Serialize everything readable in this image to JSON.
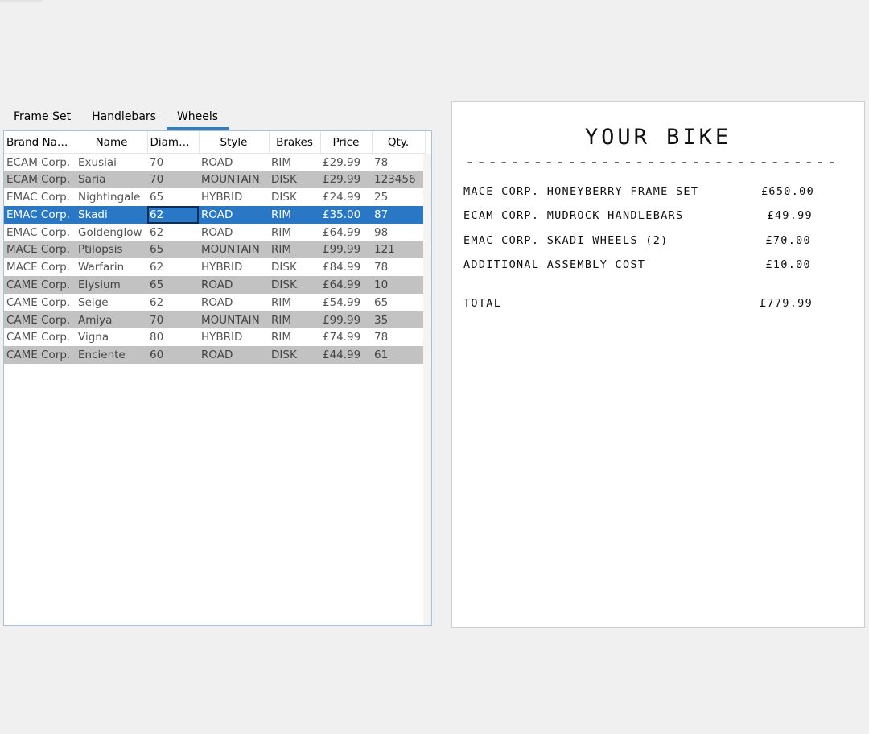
{
  "tabs": [
    {
      "label": "Frame Set",
      "active": false
    },
    {
      "label": "Handlebars",
      "active": false
    },
    {
      "label": "Wheels",
      "active": true
    }
  ],
  "table": {
    "columns": [
      "Brand Name",
      "Name",
      "Diame…",
      "Style",
      "Brakes",
      "Price",
      "Qty."
    ],
    "rows": [
      [
        "ECAM Corp.",
        "Exusiai",
        "70",
        "ROAD",
        "RIM",
        "£29.99",
        "78"
      ],
      [
        "ECAM Corp.",
        "Saria",
        "70",
        "MOUNTAIN",
        "DISK",
        "£29.99",
        "123456"
      ],
      [
        "EMAC Corp.",
        "Nightingale",
        "65",
        "HYBRID",
        "DISK",
        "£24.99",
        "25"
      ],
      [
        "EMAC Corp.",
        "Skadi",
        "62",
        "ROAD",
        "RIM",
        "£35.00",
        "87"
      ],
      [
        "EMAC Corp.",
        "Goldenglow",
        "62",
        "ROAD",
        "RIM",
        "£64.99",
        "98"
      ],
      [
        "MACE Corp.",
        "Ptilopsis",
        "65",
        "MOUNTAIN",
        "RIM",
        "£99.99",
        "121"
      ],
      [
        "MACE Corp.",
        "Warfarin",
        "62",
        "HYBRID",
        "DISK",
        "£84.99",
        "78"
      ],
      [
        "CAME Corp.",
        "Elysium",
        "65",
        "ROAD",
        "DISK",
        "£64.99",
        "10"
      ],
      [
        "CAME Corp.",
        "Seige",
        "62",
        "ROAD",
        "RIM",
        "£54.99",
        "65"
      ],
      [
        "CAME Corp.",
        "Amiya",
        "70",
        "MOUNTAIN",
        "RIM",
        "£99.99",
        "35"
      ],
      [
        "CAME Corp.",
        "Vigna",
        "80",
        "HYBRID",
        "RIM",
        "£74.99",
        "78"
      ],
      [
        "CAME Corp.",
        "Enciente",
        "60",
        "ROAD",
        "DISK",
        "£44.99",
        "61"
      ]
    ],
    "selected_row": 3,
    "focused_column": 2
  },
  "receipt": {
    "title": "YOUR BIKE",
    "rule": "------------------------------------------------",
    "items": [
      {
        "desc": "MACE CORP. HONEYBERRY FRAME SET",
        "amount": "£650.00"
      },
      {
        "desc": "ECAM CORP. MUDROCK HANDLEBARS",
        "amount": "£49.99"
      },
      {
        "desc": "EMAC CORP. SKADI WHEELS (2)",
        "amount": "£70.00"
      },
      {
        "desc": "ADDITIONAL ASSEMBLY COST",
        "amount": "£10.00"
      }
    ],
    "total_label": "TOTAL",
    "total_amount": "£779.99"
  },
  "colors": {
    "selection": "#2a77c6",
    "alt_row": "#c2c2c2",
    "tab_indicator": "#2f7fc8"
  }
}
